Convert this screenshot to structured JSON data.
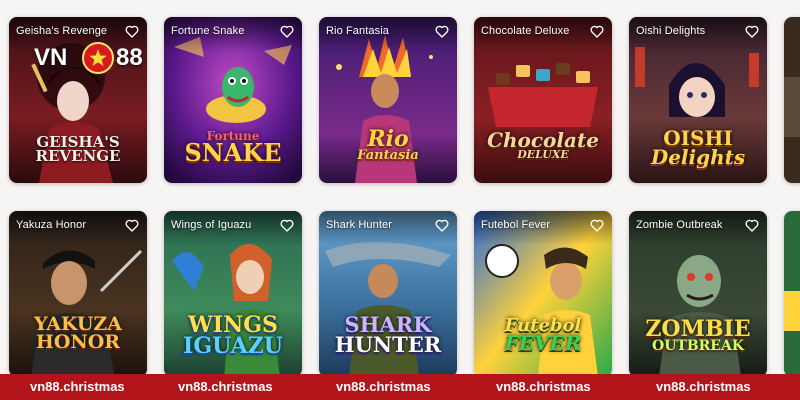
{
  "brand": {
    "left": "VN",
    "right": "88"
  },
  "watermark": "vn88.christmas",
  "games": [
    {
      "title": "Geisha's Revenge",
      "logo_lines": [
        "GEISHA'S",
        "REVENGE"
      ]
    },
    {
      "title": "Fortune Snake",
      "logo_lines": [
        "Fortune",
        "SNAKE"
      ]
    },
    {
      "title": "Rio Fantasia",
      "logo_lines": [
        "Rio",
        "Fantasia"
      ]
    },
    {
      "title": "Chocolate Deluxe",
      "logo_lines": [
        "Chocolate",
        "DELUXE"
      ]
    },
    {
      "title": "Oishi Delights",
      "logo_lines": [
        "OISHI",
        "Delights"
      ]
    },
    {
      "title": "Yakuza Honor",
      "logo_lines": [
        "YAKUZA",
        "HONOR"
      ]
    },
    {
      "title": "Wings of Iguazu",
      "logo_lines": [
        "WINGS",
        "IGUAZU"
      ]
    },
    {
      "title": "Shark Hunter",
      "logo_lines": [
        "SHARK",
        "HUNTER"
      ]
    },
    {
      "title": "Futebol Fever",
      "logo_lines": [
        "Futebol",
        "FEVER"
      ]
    },
    {
      "title": "Zombie Outbreak",
      "logo_lines": [
        "ZOMBIE",
        "OUTBREAK"
      ]
    }
  ],
  "colors": {
    "watermark_bar": "#b3141a",
    "title_text": "#ffffff"
  },
  "icons": {
    "favorite": "heart-outline-icon"
  }
}
